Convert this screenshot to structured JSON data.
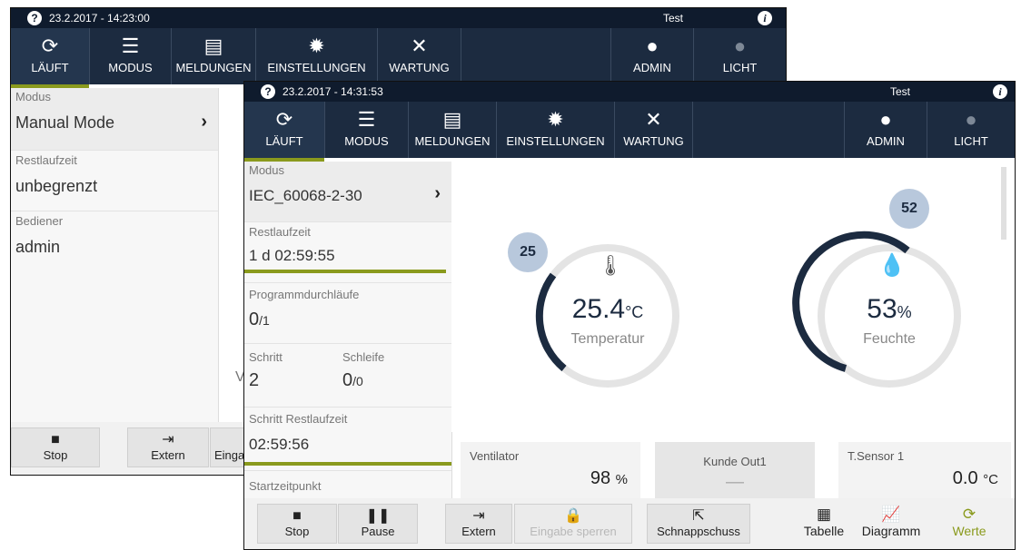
{
  "back": {
    "datetime": "23.2.2017 - 14:23:00",
    "test": "Test",
    "tabs": [
      {
        "label": "LÄUFT",
        "icon": "run-icon"
      },
      {
        "label": "MODUS",
        "icon": "sliders-icon"
      },
      {
        "label": "MELDUNGEN",
        "icon": "message-icon"
      },
      {
        "label": "EINSTELLUNGEN",
        "icon": "gear-icon"
      },
      {
        "label": "WARTUNG",
        "icon": "tools-icon"
      }
    ],
    "admin": "ADMIN",
    "licht": "LICHT",
    "sidebar": {
      "modus_label": "Modus",
      "modus_value": "Manual Mode",
      "rest_label": "Restlaufzeit",
      "rest_value": "unbegrenzt",
      "bediener_label": "Bediener",
      "bediener_value": "admin"
    },
    "partial_char": "V",
    "buttons": {
      "stop": "Stop",
      "extern": "Extern",
      "eingabe": "Einga"
    }
  },
  "front": {
    "datetime": "23.2.2017 - 14:31:53",
    "test": "Test",
    "tabs": [
      {
        "label": "LÄUFT",
        "icon": "run-icon"
      },
      {
        "label": "MODUS",
        "icon": "sliders-icon"
      },
      {
        "label": "MELDUNGEN",
        "icon": "message-icon"
      },
      {
        "label": "EINSTELLUNGEN",
        "icon": "gear-icon"
      },
      {
        "label": "WARTUNG",
        "icon": "tools-icon"
      }
    ],
    "admin": "ADMIN",
    "licht": "LICHT",
    "sidebar": {
      "modus_label": "Modus",
      "modus_value": "IEC_60068-2-30",
      "rest_label": "Restlaufzeit",
      "rest_value": "1 d 02:59:55",
      "prog_label": "Programmdurchläufe",
      "prog_value": "0",
      "prog_total": "/1",
      "schritt_label": "Schritt",
      "schritt_value": "2",
      "schleife_label": "Schleife",
      "schleife_value": "0",
      "schleife_total": "/0",
      "schritt_rest_label": "Schritt Restlaufzeit",
      "schritt_rest_value": "02:59:56",
      "start_label": "Startzeitpunkt"
    },
    "gauges": [
      {
        "setpoint": "25",
        "value": "25.4",
        "unit": "°C",
        "name": "Temperatur",
        "icon": "thermometer-icon"
      },
      {
        "setpoint": "52",
        "value": "53",
        "unit": "%",
        "name": "Feuchte",
        "icon": "droplet-icon"
      }
    ],
    "cards": [
      {
        "title": "Ventilator",
        "value": "98",
        "unit": "%"
      },
      {
        "title": "Kunde Out1",
        "value": "—"
      },
      {
        "title": "T.Sensor 1",
        "value": "0.0",
        "unit": "°C"
      }
    ],
    "buttons": {
      "stop": "Stop",
      "pause": "Pause",
      "extern": "Extern",
      "eingabe": "Eingabe sperren",
      "schnappschuss": "Schnappschuss"
    },
    "views": {
      "tabelle": "Tabelle",
      "diagramm": "Diagramm",
      "werte": "Werte"
    },
    "colors": {
      "accent": "#8a9a1d",
      "navy": "#1c2b40",
      "bubble": "#b8c8dc"
    }
  }
}
